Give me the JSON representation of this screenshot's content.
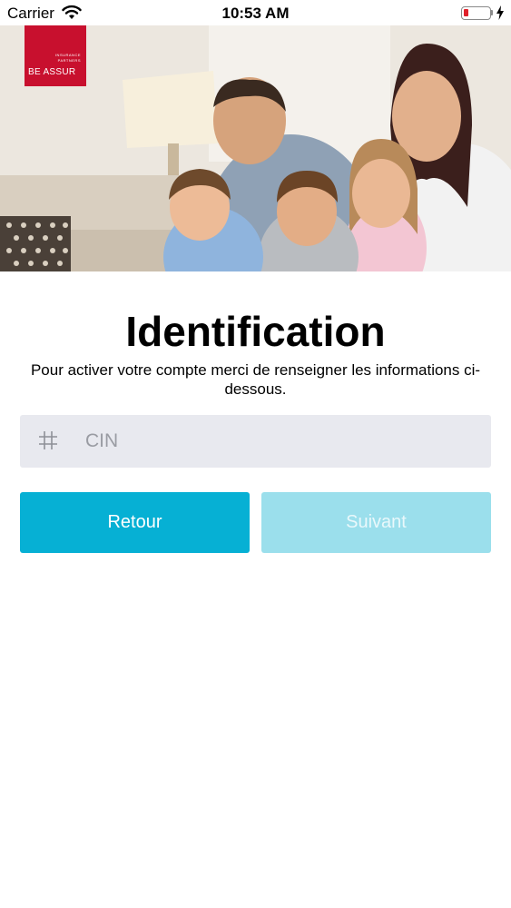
{
  "status_bar": {
    "carrier": "Carrier",
    "time": "10:53 AM",
    "battery_color": "#e0202a"
  },
  "hero": {
    "logo": {
      "tagline_line1": "INSURANCE",
      "tagline_line2": "PARTNERS",
      "name": "BE ASSUR",
      "color": "#c8102e"
    },
    "image": "family-photo"
  },
  "form": {
    "title": "Identification",
    "subtitle": "Pour activer votre compte merci de renseigner les informations ci-dessous.",
    "cin_field": {
      "icon": "hash-icon",
      "placeholder": "CIN",
      "value": ""
    },
    "back_button": {
      "label": "Retour",
      "color": "#06b0d4"
    },
    "next_button": {
      "label": "Suivant",
      "color": "#9bdfec",
      "enabled": false
    }
  }
}
